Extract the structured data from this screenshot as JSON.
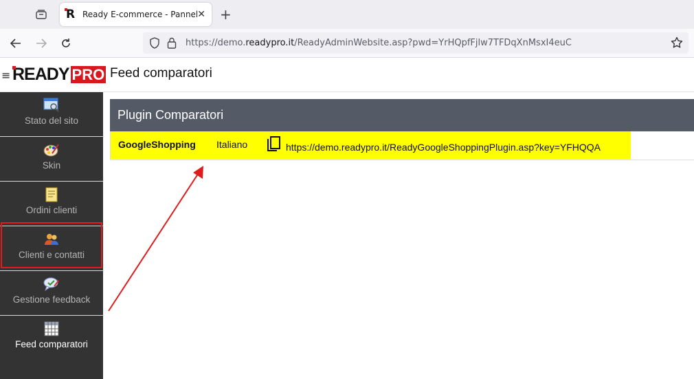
{
  "browser": {
    "tab_title": "Ready E-commerce - Pannello",
    "tab_close": "✕",
    "new_tab": "+",
    "url_prefix": "https://demo.",
    "url_domain": "readypro.it",
    "url_path": "/ReadyAdminWebsite.asp?pwd=YrHQpfFjlw7TFDqXnMsxI4euC"
  },
  "header": {
    "hamburger": "≡",
    "logo_ready": "READY",
    "logo_pro": "PRO",
    "page_title": "Feed comparatori"
  },
  "sidebar": {
    "items": [
      {
        "label": "Stato del sito",
        "icon": "site-status-icon"
      },
      {
        "label": "Skin",
        "icon": "palette-icon"
      },
      {
        "label": "Ordini clienti",
        "icon": "orders-icon"
      },
      {
        "label": "Clienti e contatti",
        "icon": "contacts-icon"
      },
      {
        "label": "Gestione feedback",
        "icon": "feedback-icon"
      },
      {
        "label": "Feed comparatori",
        "icon": "grid-icon",
        "active": true
      }
    ]
  },
  "panel": {
    "title": "Plugin Comparatori",
    "rows": [
      {
        "name": "GoogleShopping",
        "language": "Italiano",
        "url": "https://demo.readypro.it/ReadyGoogleShoppingPlugin.asp?key=YFHQQA"
      }
    ]
  },
  "colors": {
    "sidebar_bg": "#333333",
    "panel_header": "#545b67",
    "highlight": "#ffff00",
    "brand_red": "#d7181f",
    "annotation": "#e01b1b"
  }
}
